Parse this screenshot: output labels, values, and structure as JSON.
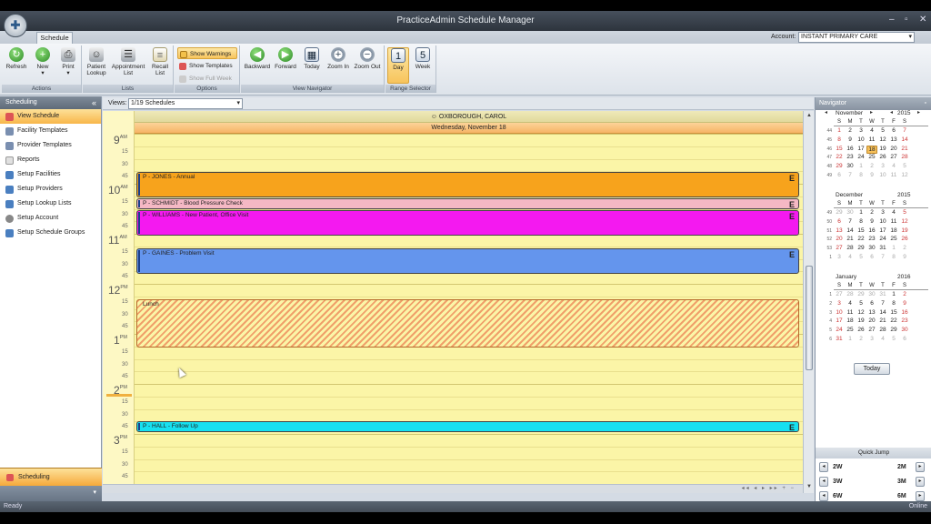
{
  "window": {
    "title": "PracticeAdmin Schedule Manager"
  },
  "tabs": {
    "schedule": "Schedule"
  },
  "account": {
    "label": "Account:",
    "value": "INSTANT PRIMARY CARE"
  },
  "ribbon": {
    "groups": {
      "actions": "Actions",
      "lists": "Lists",
      "options": "Options",
      "navigator": "View Navigator",
      "range": "Range Selector"
    },
    "refresh": "Refresh",
    "new": "New",
    "print": "Print",
    "patient_lookup_1": "Patient",
    "patient_lookup_2": "Lookup",
    "appointment_list_1": "Appointment",
    "appointment_list_2": "List",
    "recall_list_1": "Recall",
    "recall_list_2": "List",
    "show_warnings": "Show Warnings",
    "show_templates": "Show Templates",
    "show_full_week": "Show Full Week",
    "backward": "Backward",
    "forward": "Forward",
    "today": "Today",
    "zoom_in": "Zoom In",
    "zoom_out": "Zoom Out",
    "day": "Day",
    "week": "Week"
  },
  "sidebar": {
    "title": "Scheduling",
    "items": [
      {
        "label": "View Schedule"
      },
      {
        "label": "Facility Templates"
      },
      {
        "label": "Provider Templates"
      },
      {
        "label": "Reports"
      },
      {
        "label": "Setup Facilities"
      },
      {
        "label": "Setup Providers"
      },
      {
        "label": "Setup Lookup Lists"
      },
      {
        "label": "Setup Account"
      },
      {
        "label": "Setup Schedule Groups"
      }
    ],
    "footer": "Scheduling"
  },
  "views": {
    "label": "Views:",
    "value": "1/19 Schedules"
  },
  "calendar": {
    "resource": "OXBOROUGH, CAROL",
    "date": "Wednesday, November 18",
    "hours": [
      {
        "h": "9",
        "ap": "AM"
      },
      {
        "h": "10",
        "ap": "AM"
      },
      {
        "h": "11",
        "ap": "AM"
      },
      {
        "h": "12",
        "ap": "PM"
      },
      {
        "h": "1",
        "ap": "PM"
      },
      {
        "h": "2",
        "ap": "PM"
      },
      {
        "h": "3",
        "ap": "PM"
      }
    ],
    "minutes": [
      "15",
      "30",
      "45"
    ],
    "appointments": [
      {
        "label": "P - JONES - Annual",
        "flag": "E"
      },
      {
        "label": "P - SCHMIDT - Blood Pressure Check",
        "flag": "E"
      },
      {
        "label": "P - WILLIAMS - New Patient, Office Visit",
        "flag": "E"
      },
      {
        "label": "P - GAINES - Problem Visit",
        "flag": "E"
      },
      {
        "label": "P - HALL - Follow Up",
        "flag": "E"
      }
    ],
    "lunch": "Lunch"
  },
  "navigator": {
    "title": "Navigator",
    "dow": [
      "S",
      "M",
      "T",
      "W",
      "T",
      "F",
      "S"
    ],
    "months": [
      {
        "name": "November",
        "year": "2015"
      },
      {
        "name": "December",
        "year": "2015"
      },
      {
        "name": "January",
        "year": "2016"
      }
    ],
    "today_button": "Today",
    "quick_jump": {
      "title": "Quick Jump",
      "w2": "2W",
      "w3": "3W",
      "w6": "6W",
      "m2": "2M",
      "m3": "3M",
      "m6": "6M"
    }
  },
  "status": {
    "left": "Ready",
    "right": "Online"
  },
  "colors": {
    "jones": "#f7a31c",
    "schmidt": "#f5b8c4",
    "williams": "#f419f0",
    "gaines": "#6495ed",
    "hall": "#16e0f0",
    "lunch": "#f0a06a"
  }
}
